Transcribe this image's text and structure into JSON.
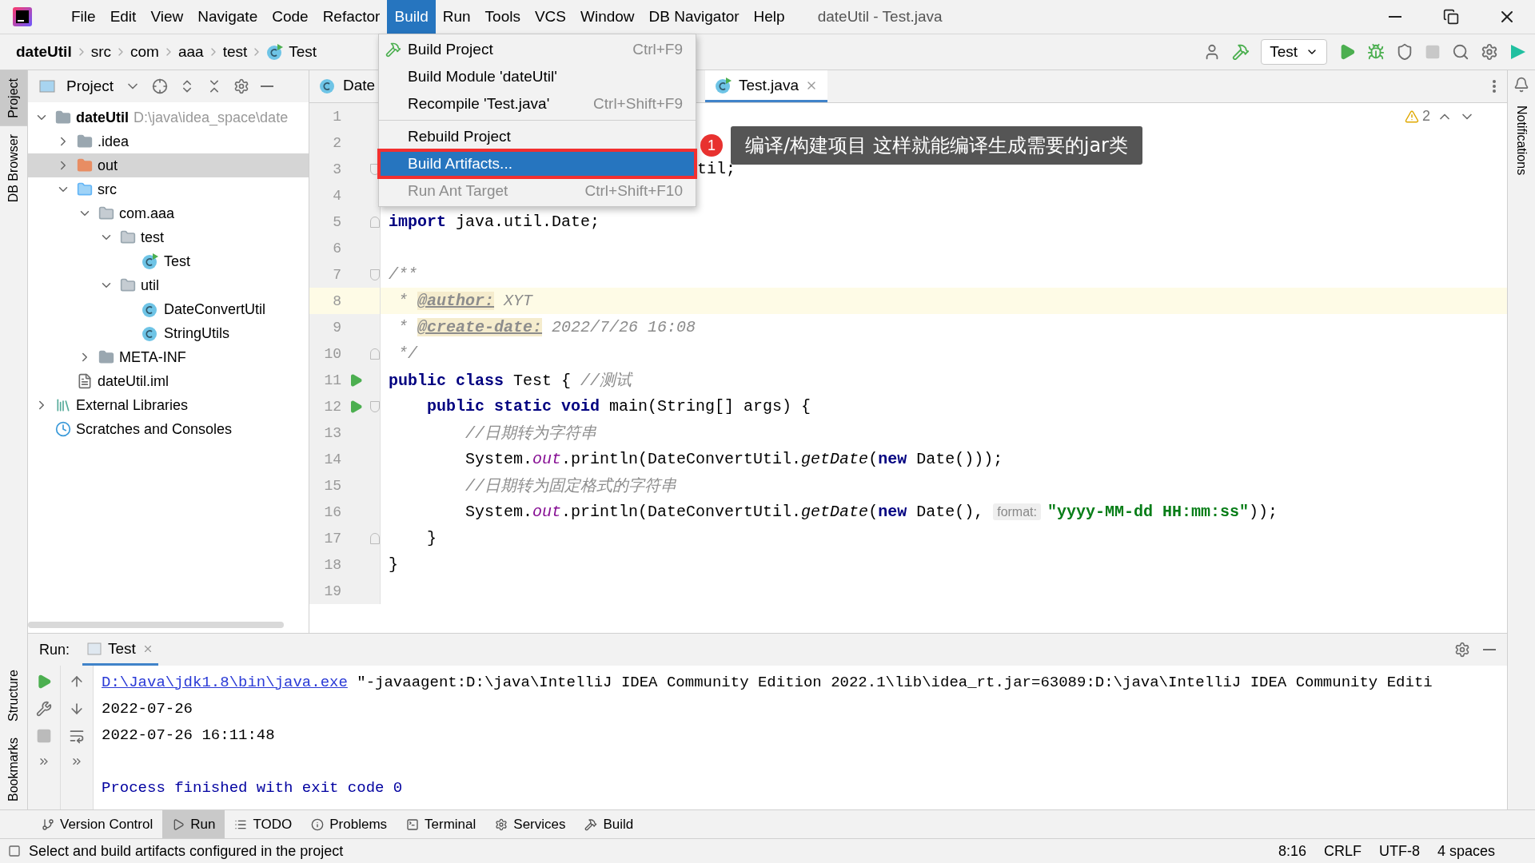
{
  "menu_bar": [
    {
      "label": "File",
      "selected": false
    },
    {
      "label": "Edit",
      "selected": false
    },
    {
      "label": "View",
      "selected": false
    },
    {
      "label": "Navigate",
      "selected": false
    },
    {
      "label": "Code",
      "selected": false
    },
    {
      "label": "Refactor",
      "selected": false
    },
    {
      "label": "Build",
      "selected": true
    },
    {
      "label": "Run",
      "selected": false
    },
    {
      "label": "Tools",
      "selected": false
    },
    {
      "label": "VCS",
      "selected": false
    },
    {
      "label": "Window",
      "selected": false
    },
    {
      "label": "DB Navigator",
      "selected": false
    },
    {
      "label": "Help",
      "selected": false
    }
  ],
  "window": {
    "title": "dateUtil - Test.java"
  },
  "breadcrumbs": [
    {
      "label": "dateUtil",
      "kind": "project"
    },
    {
      "label": "src",
      "kind": "folder"
    },
    {
      "label": "com",
      "kind": "folder"
    },
    {
      "label": "aaa",
      "kind": "folder"
    },
    {
      "label": "test",
      "kind": "folder"
    },
    {
      "label": "Test",
      "kind": "class"
    }
  ],
  "run_config": {
    "label": "Test"
  },
  "left_strip": [
    {
      "label": "Project",
      "selected": true
    },
    {
      "label": "DB Browser",
      "selected": false
    },
    {
      "label": "Structure",
      "selected": false
    },
    {
      "label": "Bookmarks",
      "selected": false
    }
  ],
  "right_strip": [
    {
      "label": "Notifications"
    }
  ],
  "project_panel": {
    "title": "Project",
    "tree": [
      {
        "label": "dateUtil",
        "hint": "D:\\java\\idea_space\\date",
        "kind": "module",
        "expanded": true,
        "selected": false,
        "children": [
          {
            "label": ".idea",
            "kind": "folder",
            "expanded": false,
            "selected": false
          },
          {
            "label": "out",
            "kind": "excluded",
            "expanded": false,
            "selected": true
          },
          {
            "label": "src",
            "kind": "source",
            "expanded": true,
            "selected": false,
            "children": [
              {
                "label": "com.aaa",
                "kind": "package",
                "expanded": true,
                "selected": false,
                "children": [
                  {
                    "label": "test",
                    "kind": "package",
                    "expanded": true,
                    "selected": false,
                    "children": [
                      {
                        "label": "Test",
                        "kind": "runnable",
                        "selected": false
                      }
                    ]
                  },
                  {
                    "label": "util",
                    "kind": "package",
                    "expanded": true,
                    "selected": false,
                    "children": [
                      {
                        "label": "DateConvertUtil",
                        "kind": "class",
                        "selected": false
                      },
                      {
                        "label": "StringUtils",
                        "kind": "class",
                        "selected": false
                      }
                    ]
                  }
                ]
              },
              {
                "label": "META-INF",
                "kind": "folder",
                "expanded": false,
                "selected": false
              }
            ]
          },
          {
            "label": "dateUtil.iml",
            "kind": "file",
            "selected": false
          }
        ]
      },
      {
        "label": "External Libraries",
        "kind": "libraries",
        "expanded": false,
        "selected": false
      },
      {
        "label": "Scratches and Consoles",
        "kind": "scratches",
        "selected": false
      }
    ]
  },
  "editor_tabs": [
    {
      "label": "Date",
      "selected": false,
      "kind": "class"
    },
    {
      "label": "Test.java",
      "selected": true,
      "kind": "runnable"
    }
  ],
  "inspections": {
    "warnings": "2"
  },
  "code_lines": [
    {
      "number": "1",
      "current": false
    },
    {
      "number": "2",
      "current": false
    },
    {
      "number": "3",
      "current": false,
      "kind": "covered",
      "fold_start": true,
      "tokens": [
        {
          "kind": "plain",
          "text": "til;"
        }
      ]
    },
    {
      "number": "4",
      "current": false
    },
    {
      "number": "5",
      "current": false,
      "fold_end": true,
      "tokens": [
        {
          "kind": "kw",
          "text": "import"
        },
        {
          "kind": "plain",
          "text": " java.util.Date;"
        }
      ]
    },
    {
      "number": "6",
      "current": false
    },
    {
      "number": "7",
      "current": false,
      "fold_start": true,
      "tokens": [
        {
          "kind": "doc",
          "text": "/**"
        }
      ]
    },
    {
      "number": "8",
      "current": true,
      "tokens": [
        {
          "kind": "doc",
          "text": " * "
        },
        {
          "kind": "tag",
          "text": "@author:"
        },
        {
          "kind": "doc",
          "text": " XYT"
        }
      ]
    },
    {
      "number": "9",
      "current": false,
      "tokens": [
        {
          "kind": "doc",
          "text": " * "
        },
        {
          "kind": "tag",
          "text": "@create-date:"
        },
        {
          "kind": "doc",
          "text": " 2022/7/26 16:08"
        }
      ]
    },
    {
      "number": "10",
      "current": false,
      "fold_end": true,
      "tokens": [
        {
          "kind": "doc",
          "text": " */"
        }
      ]
    },
    {
      "number": "11",
      "current": false,
      "run": true,
      "tokens": [
        {
          "kind": "kw",
          "text": "public class"
        },
        {
          "kind": "plain",
          "text": " Test { "
        },
        {
          "kind": "comment",
          "text": "//测试"
        }
      ]
    },
    {
      "number": "12",
      "current": false,
      "run": true,
      "fold_start": true,
      "tokens": [
        {
          "kind": "kw",
          "text": "    public static void"
        },
        {
          "kind": "plain",
          "text": " main(String[] args) {"
        }
      ]
    },
    {
      "number": "13",
      "current": false,
      "tokens": [
        {
          "kind": "comment",
          "text": "        //日期转为字符串"
        }
      ]
    },
    {
      "number": "14",
      "current": false,
      "tokens": [
        {
          "kind": "plain",
          "text": "        System."
        },
        {
          "kind": "static",
          "text": "out"
        },
        {
          "kind": "plain",
          "text": ".println(DateConvertUtil."
        },
        {
          "kind": "method",
          "text": "getDate"
        },
        {
          "kind": "plain",
          "text": "("
        },
        {
          "kind": "kw",
          "text": "new"
        },
        {
          "kind": "plain",
          "text": " Date()));"
        }
      ]
    },
    {
      "number": "15",
      "current": false,
      "tokens": [
        {
          "kind": "comment",
          "text": "        //日期转为固定格式的字符串"
        }
      ]
    },
    {
      "number": "16",
      "current": false,
      "tokens": [
        {
          "kind": "plain",
          "text": "        System."
        },
        {
          "kind": "static",
          "text": "out"
        },
        {
          "kind": "plain",
          "text": ".println(DateConvertUtil."
        },
        {
          "kind": "method",
          "text": "getDate"
        },
        {
          "kind": "plain",
          "text": "("
        },
        {
          "kind": "kw",
          "text": "new"
        },
        {
          "kind": "plain",
          "text": " Date(), "
        },
        {
          "kind": "hint",
          "text": "format:"
        },
        {
          "kind": "string",
          "text": "\"yyyy-MM-dd HH:mm:ss\""
        },
        {
          "kind": "plain",
          "text": "));"
        }
      ]
    },
    {
      "number": "17",
      "current": false,
      "fold_end": true,
      "tokens": [
        {
          "kind": "plain",
          "text": "    }"
        }
      ]
    },
    {
      "number": "18",
      "current": false,
      "tokens": [
        {
          "kind": "plain",
          "text": "}"
        }
      ]
    },
    {
      "number": "19",
      "current": false
    }
  ],
  "build_menu": [
    {
      "kind": "item",
      "label": "Build Project",
      "shortcut": "Ctrl+F9",
      "icon": true,
      "selected": false,
      "disabled": false
    },
    {
      "kind": "item",
      "label": "Build Module 'dateUtil'",
      "selected": false,
      "disabled": false
    },
    {
      "kind": "item",
      "label": "Recompile 'Test.java'",
      "shortcut": "Ctrl+Shift+F9",
      "selected": false,
      "disabled": false
    },
    {
      "kind": "separator"
    },
    {
      "kind": "item",
      "label": "Rebuild Project",
      "selected": false,
      "disabled": false
    },
    {
      "kind": "item",
      "label": "Build Artifacts...",
      "selected": true,
      "disabled": false
    },
    {
      "kind": "item",
      "label": "Run Ant Target",
      "shortcut": "Ctrl+Shift+F10",
      "selected": false,
      "disabled": true
    }
  ],
  "callout": {
    "badge": "1",
    "text": "编译/构建项目 这样就能编译生成需要的jar类"
  },
  "run_panel": {
    "title": "Run:",
    "tab": "Test",
    "output": [
      {
        "kind": "command",
        "link": "D:\\Java\\jdk1.8\\bin\\java.exe",
        "text": " \"-javaagent:D:\\java\\IntelliJ IDEA Community Edition 2022.1\\lib\\idea_rt.jar=63089:D:\\java\\IntelliJ IDEA Community Editi"
      },
      {
        "kind": "plain",
        "text": "2022-07-26"
      },
      {
        "kind": "plain",
        "text": "2022-07-26 16:11:48"
      },
      {
        "kind": "process",
        "text": "Process finished with exit code 0"
      }
    ]
  },
  "tool_windows": [
    {
      "label": "Version Control",
      "kind": "vcs",
      "selected": false
    },
    {
      "label": "Run",
      "kind": "run",
      "selected": true
    },
    {
      "label": "TODO",
      "kind": "todo",
      "selected": false
    },
    {
      "label": "Problems",
      "kind": "problems",
      "selected": false
    },
    {
      "label": "Terminal",
      "kind": "terminal",
      "selected": false
    },
    {
      "label": "Services",
      "kind": "services",
      "selected": false
    },
    {
      "label": "Build",
      "kind": "build",
      "selected": false
    }
  ],
  "status_bar": {
    "message": "Select and build artifacts configured in the project",
    "position": "8:16",
    "line_separator": "CRLF",
    "encoding": "UTF-8",
    "indent": "4 spaces"
  }
}
